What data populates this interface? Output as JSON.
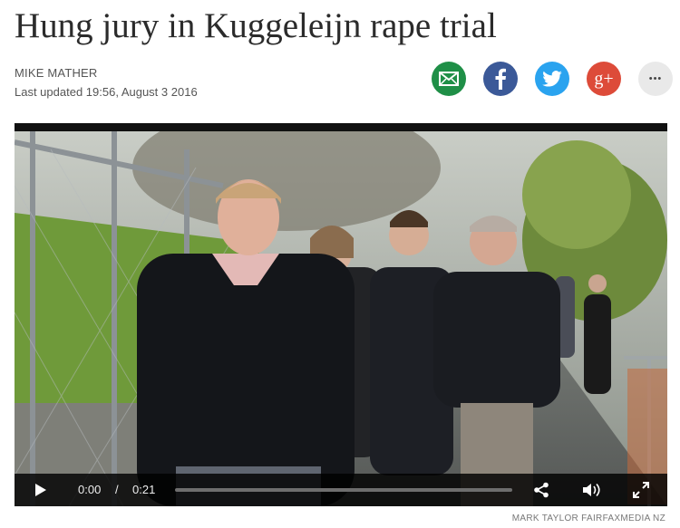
{
  "article": {
    "headline": "Hung jury in Kuggeleijn rape trial",
    "author": "MIKE MATHER",
    "updated": "Last updated 19:56, August 3 2016"
  },
  "share": {
    "buttons": [
      {
        "name": "email",
        "icon": "email-icon",
        "color": "#1f8f47"
      },
      {
        "name": "facebook",
        "icon": "facebook-icon",
        "color": "#3b5998"
      },
      {
        "name": "twitter",
        "icon": "twitter-icon",
        "color": "#2aa3ef"
      },
      {
        "name": "google-plus",
        "icon": "google-plus-icon",
        "color": "#dd4b39"
      },
      {
        "name": "more",
        "icon": "more-icon",
        "color": "#e9e9e9"
      }
    ],
    "gplus_glyph": "g+",
    "more_glyph": "•••"
  },
  "video": {
    "current_time": "0:00",
    "separator": "/",
    "duration": "0:21",
    "progress_fraction": 0.0,
    "credit": "MARK TAYLOR FAIRFAXMEDIA NZ"
  }
}
